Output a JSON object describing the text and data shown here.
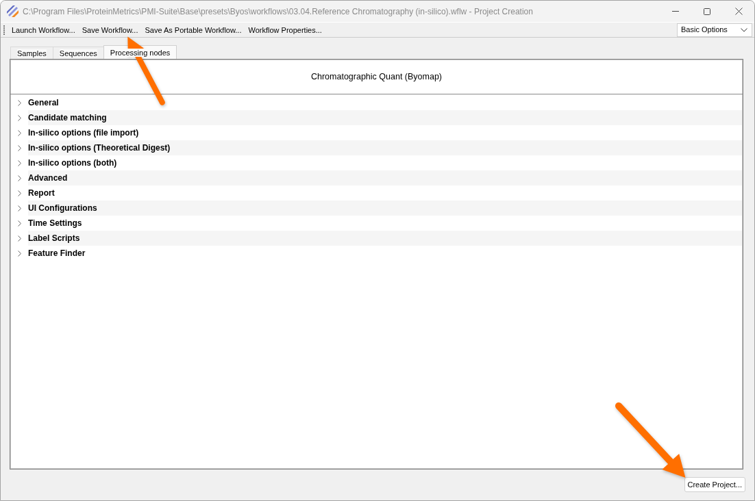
{
  "window": {
    "title": "C:\\Program Files\\ProteinMetrics\\PMI-Suite\\Base\\presets\\Byos\\workflows\\03.04.Reference Chromatography (in-silico).wflw - Project Creation"
  },
  "toolbar": {
    "buttons": [
      "Launch Workflow...",
      "Save Workflow...",
      "Save As Portable Workflow...",
      "Workflow Properties..."
    ],
    "options_dropdown": {
      "value": "Basic Options"
    }
  },
  "tabs": [
    {
      "label": "Samples",
      "selected": false
    },
    {
      "label": "Sequences",
      "selected": false
    },
    {
      "label": "Processing nodes",
      "selected": true
    }
  ],
  "panel": {
    "header": "Chromatographic Quant (Byomap)",
    "tree": [
      {
        "label": "General",
        "expanded": false
      },
      {
        "label": "Candidate matching",
        "expanded": false
      },
      {
        "label": "In-silico options (file import)",
        "expanded": false
      },
      {
        "label": "In-silico options (Theoretical Digest)",
        "expanded": false
      },
      {
        "label": "In-silico options (both)",
        "expanded": false
      },
      {
        "label": "Advanced",
        "expanded": false
      },
      {
        "label": "Report",
        "expanded": false
      },
      {
        "label": "UI Configurations",
        "expanded": false
      },
      {
        "label": "Time Settings",
        "expanded": false
      },
      {
        "label": "Label Scripts",
        "expanded": false
      },
      {
        "label": "Feature Finder",
        "expanded": false
      }
    ]
  },
  "footer": {
    "buttons": [
      "Create Project..."
    ]
  }
}
